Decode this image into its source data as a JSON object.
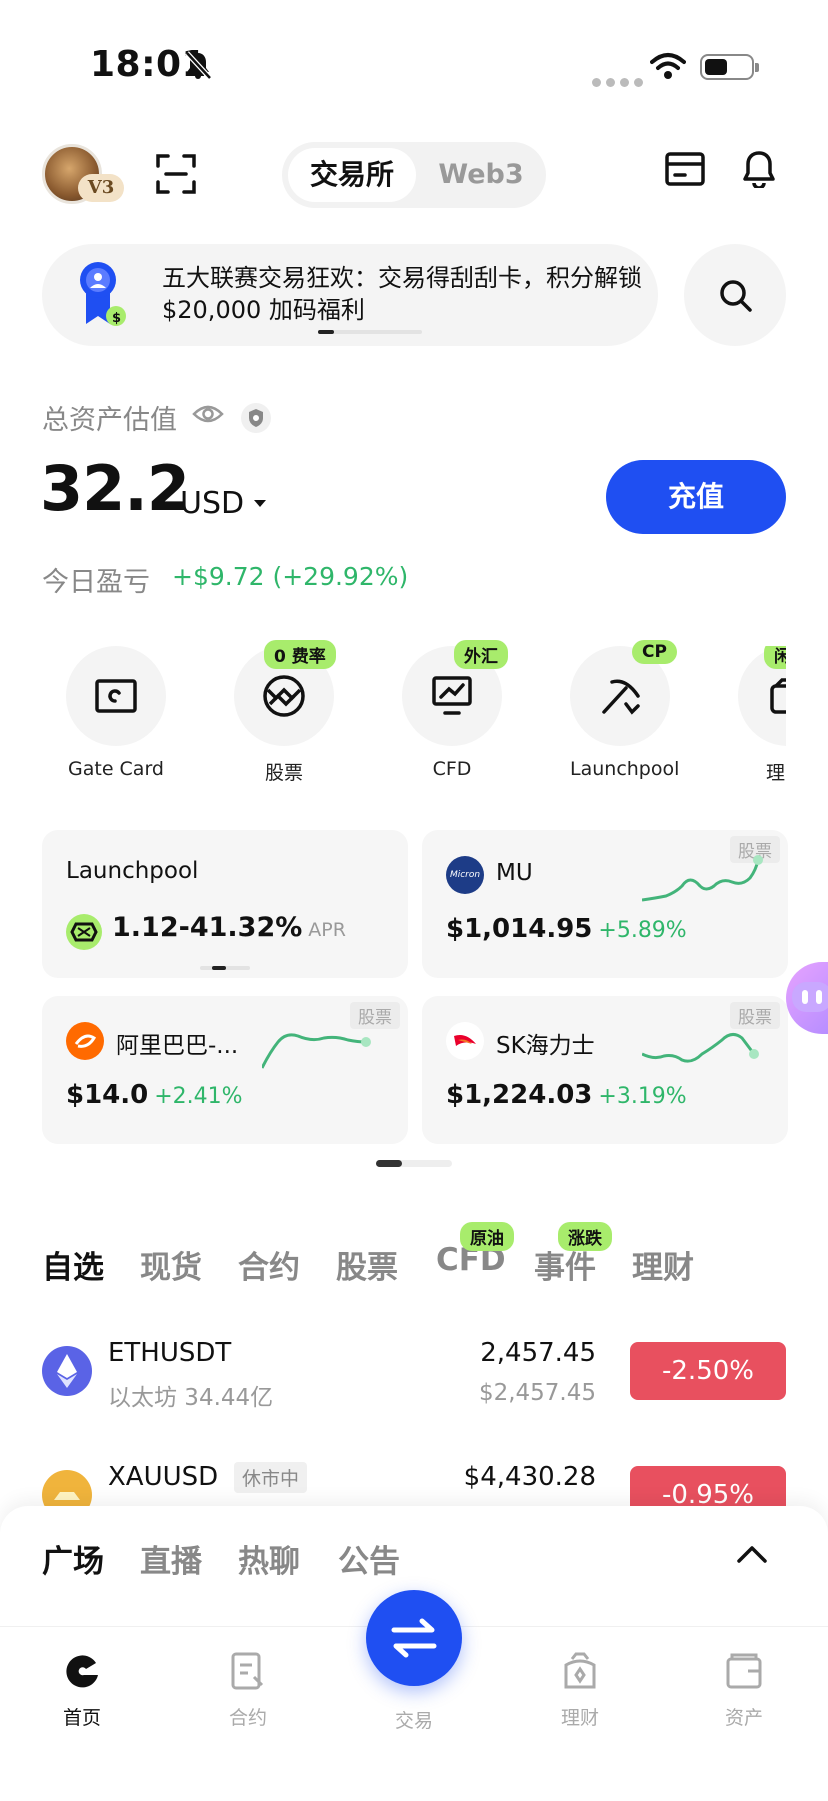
{
  "status_bar": {
    "time": "18:01"
  },
  "header": {
    "vip_badge": "V3",
    "segment": {
      "exchange": "交易所",
      "web3": "Web3"
    }
  },
  "banner": {
    "text": "五大联赛交易狂欢：交易得刮刮卡，积分解锁 $20,000 加码福利"
  },
  "assets": {
    "label": "总资产估值",
    "value": "32.2",
    "unit": "USD",
    "deposit_label": "充值",
    "pnl_label": "今日盈亏",
    "pnl_value": "+$9.72 (+29.92%)"
  },
  "quick_entries": [
    {
      "label": "Gate Card",
      "tag": "",
      "icon": "card-icon"
    },
    {
      "label": "股票",
      "tag": "0 费率",
      "icon": "globe-icon"
    },
    {
      "label": "CFD",
      "tag": "外汇",
      "icon": "chart-monitor-icon"
    },
    {
      "label": "Launchpool",
      "tag": "CP",
      "icon": "pickaxe-icon"
    },
    {
      "label": "理",
      "tag": "闲",
      "icon": "wallet-icon"
    }
  ],
  "market_cards": [
    {
      "title": "Launchpool",
      "apr": "1.12-41.32%",
      "apr_unit": "APR"
    },
    {
      "tag": "股票",
      "name": "MU",
      "price": "$1,014.95",
      "change": "+5.89%",
      "logo_text": "Micron"
    },
    {
      "tag": "股票",
      "name": "阿里巴巴-...",
      "price": "$14.0",
      "change": "+2.41%"
    },
    {
      "tag": "股票",
      "name": "SK海力士",
      "price": "$1,224.03",
      "change": "+3.19%"
    }
  ],
  "market_tabs": [
    {
      "label": "自选",
      "active": true,
      "tag": ""
    },
    {
      "label": "现货",
      "active": false,
      "tag": ""
    },
    {
      "label": "合约",
      "active": false,
      "tag": ""
    },
    {
      "label": "股票",
      "active": false,
      "tag": ""
    },
    {
      "label": "CFD",
      "active": false,
      "tag": "原油"
    },
    {
      "label": "事件",
      "active": false,
      "tag": "涨跌"
    },
    {
      "label": "理财",
      "active": false,
      "tag": ""
    }
  ],
  "rows": [
    {
      "symbol": "ETHUSDT",
      "sub": "以太坊 34.44亿",
      "price": "2,457.45",
      "price_sub": "$2,457.45",
      "change": "-2.50%",
      "change_color": "#e8505f"
    },
    {
      "symbol": "XAUUSD",
      "badge": "休市中",
      "price": "$4,430.28",
      "change": "-0.95%",
      "change_color": "#e8505f"
    }
  ],
  "square_tabs": [
    {
      "label": "广场",
      "active": true
    },
    {
      "label": "直播",
      "active": false
    },
    {
      "label": "热聊",
      "active": false
    },
    {
      "label": "公告",
      "active": false
    }
  ],
  "bottom_nav": [
    {
      "label": "首页",
      "active": true
    },
    {
      "label": "合约",
      "active": false
    },
    {
      "label": "交易",
      "active": false
    },
    {
      "label": "理财",
      "active": false
    },
    {
      "label": "资产",
      "active": false
    }
  ],
  "colors": {
    "accent": "#1f4ff2",
    "up": "#2fb66a",
    "down": "#e8505f",
    "tag": "#a8ec6c"
  }
}
